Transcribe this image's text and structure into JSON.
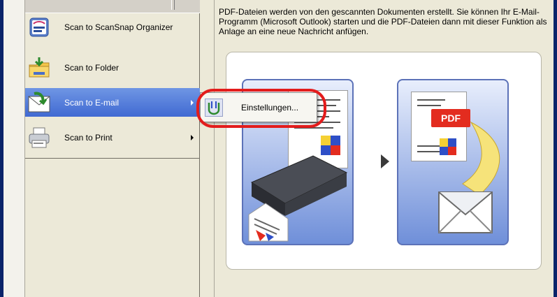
{
  "menu": {
    "items": [
      {
        "label": "Scan to ScanSnap Organizer",
        "icon": "scansnap-organizer-icon",
        "active": false
      },
      {
        "label": "Scan to Folder",
        "icon": "folder-icon",
        "active": false
      },
      {
        "label": "Scan to E-mail",
        "icon": "email-icon",
        "active": true,
        "has_submenu": true
      },
      {
        "label": "Scan to Print",
        "icon": "printer-icon",
        "active": false,
        "has_submenu": true
      }
    ]
  },
  "submenu": {
    "items": [
      {
        "label": "Einstellungen...",
        "icon": "settings-icon"
      }
    ]
  },
  "content": {
    "description": "PDF-Dateien werden von den gescannten Dokumenten erstellt. Sie können Ihr E-Mail-Programm (Microsoft Outlook) starten und die PDF-Dateien dann mit dieser Funktion als Anlage an eine neue Nachricht anfügen.",
    "pdf_badge": "PDF"
  },
  "colors": {
    "accent": "#4069d2",
    "highlight_ring": "#e31c1c",
    "pdf_red": "#e32c1f"
  }
}
